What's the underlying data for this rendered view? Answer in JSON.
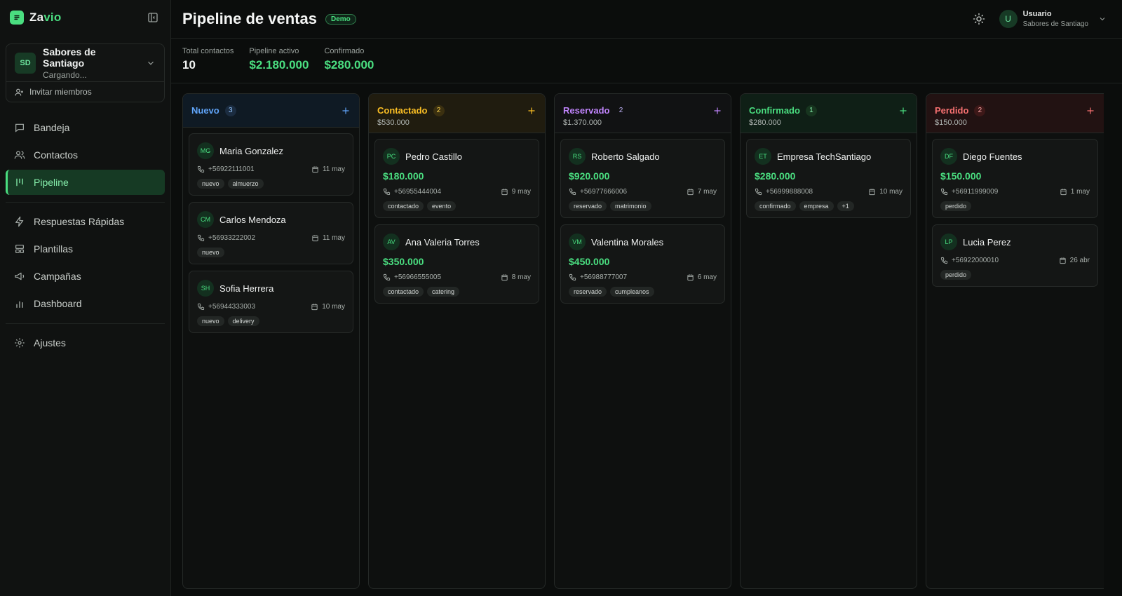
{
  "app": {
    "brand_a": "Za",
    "brand_b": "vio"
  },
  "org": {
    "initials": "SD",
    "name": "Sabores de Santiago",
    "status": "Cargando...",
    "invite_label": "Invitar miembros"
  },
  "nav": {
    "bandeja": "Bandeja",
    "contactos": "Contactos",
    "pipeline": "Pipeline",
    "respuestas": "Respuestas Rápidas",
    "plantillas": "Plantillas",
    "campanas": "Campañas",
    "dashboard": "Dashboard",
    "ajustes": "Ajustes"
  },
  "header": {
    "title": "Pipeline de ventas",
    "badge": "Demo"
  },
  "user": {
    "initial": "U",
    "name": "Usuario",
    "org": "Sabores de Santiago"
  },
  "stats": [
    {
      "label": "Total contactos",
      "value": "10"
    },
    {
      "label": "Pipeline activo",
      "value": "$2.180.000"
    },
    {
      "label": "Confirmado",
      "value": "$280.000"
    }
  ],
  "columns": [
    {
      "title": "Nuevo",
      "count": "3",
      "total": "",
      "cards": [
        {
          "initials": "MG",
          "name": "Maria Gonzalez",
          "amount": "",
          "phone": "+56922111001",
          "date": "11 may",
          "tags": [
            "nuevo",
            "almuerzo"
          ]
        },
        {
          "initials": "CM",
          "name": "Carlos Mendoza",
          "amount": "",
          "phone": "+56933222002",
          "date": "11 may",
          "tags": [
            "nuevo"
          ]
        },
        {
          "initials": "SH",
          "name": "Sofia Herrera",
          "amount": "",
          "phone": "+56944333003",
          "date": "10 may",
          "tags": [
            "nuevo",
            "delivery"
          ]
        }
      ]
    },
    {
      "title": "Contactado",
      "count": "2",
      "total": "$530.000",
      "cards": [
        {
          "initials": "PC",
          "name": "Pedro Castillo",
          "amount": "$180.000",
          "phone": "+56955444004",
          "date": "9 may",
          "tags": [
            "contactado",
            "evento"
          ]
        },
        {
          "initials": "AV",
          "name": "Ana Valeria Torres",
          "amount": "$350.000",
          "phone": "+56966555005",
          "date": "8 may",
          "tags": [
            "contactado",
            "catering"
          ]
        }
      ]
    },
    {
      "title": "Reservado",
      "count": "2",
      "total": "$1.370.000",
      "cards": [
        {
          "initials": "RS",
          "name": "Roberto Salgado",
          "amount": "$920.000",
          "phone": "+56977666006",
          "date": "7 may",
          "tags": [
            "reservado",
            "matrimonio"
          ]
        },
        {
          "initials": "VM",
          "name": "Valentina Morales",
          "amount": "$450.000",
          "phone": "+56988777007",
          "date": "6 may",
          "tags": [
            "reservado",
            "cumpleanos"
          ]
        }
      ]
    },
    {
      "title": "Confirmado",
      "count": "1",
      "total": "$280.000",
      "cards": [
        {
          "initials": "ET",
          "name": "Empresa TechSantiago",
          "amount": "$280.000",
          "phone": "+56999888008",
          "date": "10 may",
          "tags": [
            "confirmado",
            "empresa",
            "+1"
          ]
        }
      ]
    },
    {
      "title": "Perdido",
      "count": "2",
      "total": "$150.000",
      "cards": [
        {
          "initials": "DF",
          "name": "Diego Fuentes",
          "amount": "$150.000",
          "phone": "+56911999009",
          "date": "1 may",
          "tags": [
            "perdido"
          ]
        },
        {
          "initials": "LP",
          "name": "Lucia Perez",
          "amount": "",
          "phone": "+56922000010",
          "date": "26 abr",
          "tags": [
            "perdido"
          ]
        }
      ]
    }
  ],
  "colors": {
    "accent": "#4ade80",
    "nuevo": "#60a5fa",
    "contactado": "#fbbf24",
    "reservado": "#c084fc",
    "confirmado": "#4ade80",
    "perdido": "#f87171"
  },
  "icons": [
    "chat-logo-icon",
    "sidebar-collapse-icon",
    "chevron-down-icon",
    "user-plus-icon",
    "message-icon",
    "users-icon",
    "pipeline-icon",
    "zap-icon",
    "template-icon",
    "megaphone-icon",
    "bar-chart-icon",
    "gear-icon",
    "sun-icon",
    "plus-icon",
    "phone-icon",
    "calendar-icon"
  ]
}
